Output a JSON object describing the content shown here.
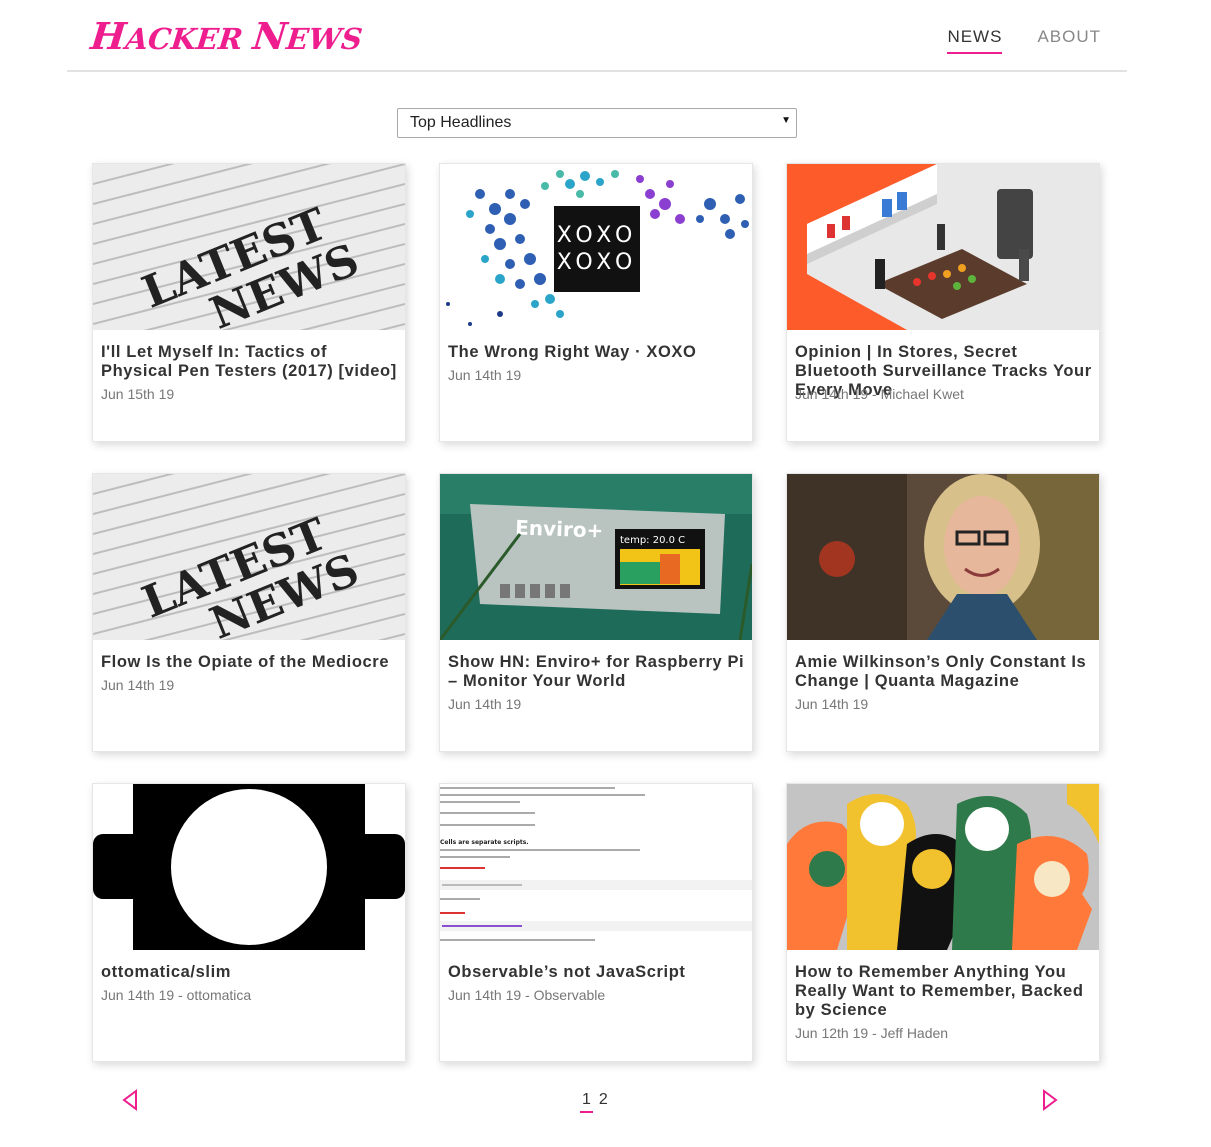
{
  "header": {
    "logo_part1": "H",
    "logo_part2": "ACKER ",
    "logo_part3": "N",
    "logo_part4": "EWS",
    "nav": [
      {
        "label": "NEWS",
        "active": true
      },
      {
        "label": "ABOUT",
        "active": false
      }
    ]
  },
  "filter": {
    "selected": "Top Headlines",
    "arrow": "▼"
  },
  "colors": {
    "accent": "#ee1e8f",
    "text": "#333333",
    "muted": "#777777",
    "divider": "#e2e2e2"
  },
  "cards": [
    {
      "title": "I'll Let Myself In: Tactics of Physical Pen Testers (2017) [video]",
      "meta": "Jun 15th 19",
      "image": "latest-news-newspaper"
    },
    {
      "title": "The Wrong Right Way · XOXO",
      "meta": "Jun 14th 19",
      "image": "xoxo-dots-logo"
    },
    {
      "title": "Opinion | In Stores, Secret Bluetooth Surveillance Tracks Your Every Move",
      "meta": "Jun 14th 19 - Michael Kwet",
      "image": "store-isometric-illustration"
    },
    {
      "title": "Flow Is the Opiate of the Mediocre",
      "meta": "Jun 14th 19",
      "image": "latest-news-newspaper"
    },
    {
      "title": "Show HN: Enviro+ for Raspberry Pi – Monitor Your World",
      "meta": "Jun 14th 19",
      "image": "enviro-board-photo",
      "board_label": "Enviro+",
      "temp_label": "temp: 20.0 C"
    },
    {
      "title": "Amie Wilkinson’s Only Constant Is Change | Quanta Magazine",
      "meta": "Jun 14th 19",
      "image": "portrait-photo"
    },
    {
      "title": "ottomatica/slim",
      "meta": "Jun 14th 19 - ottomatica",
      "image": "gear-logo"
    },
    {
      "title": "Observable’s not JavaScript",
      "meta": "Jun 14th 19 - Observable",
      "image": "observable-doc-screenshot",
      "doc_heading": "Cells are separate scripts."
    },
    {
      "title": "How to Remember Anything You Really Want to Remember, Backed by Science",
      "meta": "Jun 12th 19 - Jeff Haden",
      "image": "heads-illustration"
    }
  ],
  "pager": {
    "prev_icon": "triangle-left-icon",
    "next_icon": "triangle-right-icon",
    "pages": [
      {
        "label": "1",
        "active": true
      },
      {
        "label": "2",
        "active": false
      }
    ]
  }
}
